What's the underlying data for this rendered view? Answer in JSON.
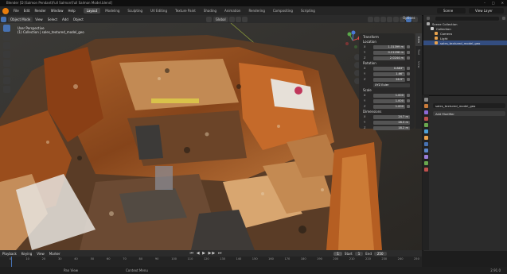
{
  "window": {
    "title": "Blender [D:\\Salmon Pendant\\Full Salmon\\Full Salmon Model.blend]",
    "controls": [
      "–",
      "□",
      "✕"
    ]
  },
  "menu": [
    "File",
    "Edit",
    "Render",
    "Window",
    "Help"
  ],
  "workspaces": [
    {
      "label": "Layout",
      "active": true
    },
    {
      "label": "Modeling",
      "active": false
    },
    {
      "label": "Sculpting",
      "active": false
    },
    {
      "label": "UV Editing",
      "active": false
    },
    {
      "label": "Texture Paint",
      "active": false
    },
    {
      "label": "Shading",
      "active": false
    },
    {
      "label": "Animation",
      "active": false
    },
    {
      "label": "Rendering",
      "active": false
    },
    {
      "label": "Compositing",
      "active": false
    },
    {
      "label": "Scripting",
      "active": false
    }
  ],
  "scene": "Scene",
  "view_layer": "View Layer",
  "viewport_header": {
    "mode": "Object Mode",
    "menus": [
      "View",
      "Select",
      "Add",
      "Object"
    ],
    "orientation": "Global",
    "options": "Options"
  },
  "viewport_info": {
    "line1": "User Perspective",
    "line2": "(1) Collection | sales_textured_model_geo"
  },
  "npanel": {
    "title": "Transform",
    "location_label": "Location",
    "location": [
      {
        "axis": "X",
        "value": "1.31399 m"
      },
      {
        "axis": "Y",
        "value": "0.21298 m"
      },
      {
        "axis": "Z",
        "value": "2.0244 m"
      }
    ],
    "rotation_label": "Rotation",
    "rotation": [
      {
        "axis": "X",
        "value": "0.883°"
      },
      {
        "axis": "Y",
        "value": "1.66°"
      },
      {
        "axis": "Z",
        "value": "26.9°"
      }
    ],
    "rotation_mode": "XYZ Euler",
    "scale_label": "Scale",
    "scale": [
      {
        "axis": "X",
        "value": "1.000"
      },
      {
        "axis": "Y",
        "value": "1.000"
      },
      {
        "axis": "Z",
        "value": "1.000"
      }
    ],
    "dimensions_label": "Dimensions",
    "dimensions": [
      {
        "axis": "X",
        "value": "24.7 m"
      },
      {
        "axis": "Y",
        "value": "28.3 m"
      },
      {
        "axis": "Z",
        "value": "18.2 m"
      }
    ],
    "tabs": [
      "Item",
      "Tool",
      "View"
    ]
  },
  "outliner": {
    "root": "Scene Collection",
    "items": [
      {
        "label": "Collection",
        "indent": 1,
        "color": "#cfcfcf"
      },
      {
        "label": "Camera",
        "indent": 2,
        "color": "#e8a24c"
      },
      {
        "label": "Light",
        "indent": 2,
        "color": "#e8a24c"
      },
      {
        "label": "sales_textured_model_geo",
        "indent": 2,
        "color": "#e8a24c"
      }
    ]
  },
  "properties": {
    "object_name": "sales_textured_model_geo",
    "add_modifier": "Add Modifier",
    "tab_colors": [
      "#888",
      "#c97b3a",
      "#8c6ad8",
      "#c0504d",
      "#6aa84f",
      "#4ea0d8",
      "#4ea0d8",
      "#d89a3b",
      "#c0504d",
      "#5c86c8",
      "#9a7dd8",
      "#6aa84f"
    ]
  },
  "timeline": {
    "menus": [
      "Playback",
      "Keying",
      "View",
      "Marker"
    ],
    "current_frame": "1",
    "start_label": "Start",
    "start": "1",
    "end_label": "End",
    "end": "250",
    "ticks": [
      "0",
      "10",
      "20",
      "30",
      "40",
      "50",
      "60",
      "70",
      "80",
      "90",
      "100",
      "110",
      "120",
      "130",
      "140",
      "150",
      "160",
      "170",
      "180",
      "190",
      "200",
      "210",
      "220",
      "230",
      "240",
      "250"
    ]
  },
  "status": {
    "left": "Pan View",
    "middle": "Context Menu",
    "version": "2.91.0"
  }
}
